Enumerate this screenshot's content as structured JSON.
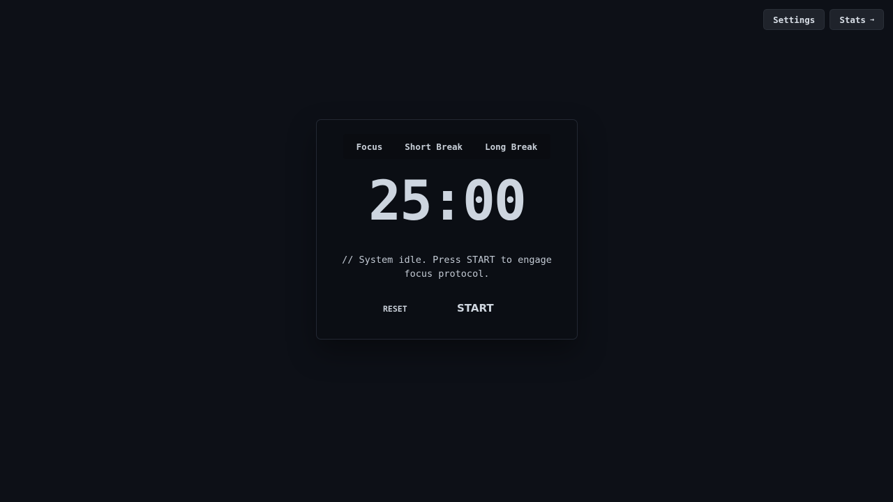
{
  "nav": {
    "settings_label": "Settings",
    "stats_label": "Stats",
    "stats_arrow": "→"
  },
  "tabs": [
    {
      "label": "Focus"
    },
    {
      "label": "Short Break"
    },
    {
      "label": "Long Break"
    }
  ],
  "timer": {
    "display": "25:00"
  },
  "status": {
    "line1": "// System idle. Press START to engage",
    "line2": "focus protocol."
  },
  "controls": {
    "reset_label": "RESET",
    "start_label": "START"
  },
  "colors": {
    "background": "#0d1017",
    "card": "#0b0e14",
    "text": "#c9d1d9",
    "button": "#1f232b"
  }
}
